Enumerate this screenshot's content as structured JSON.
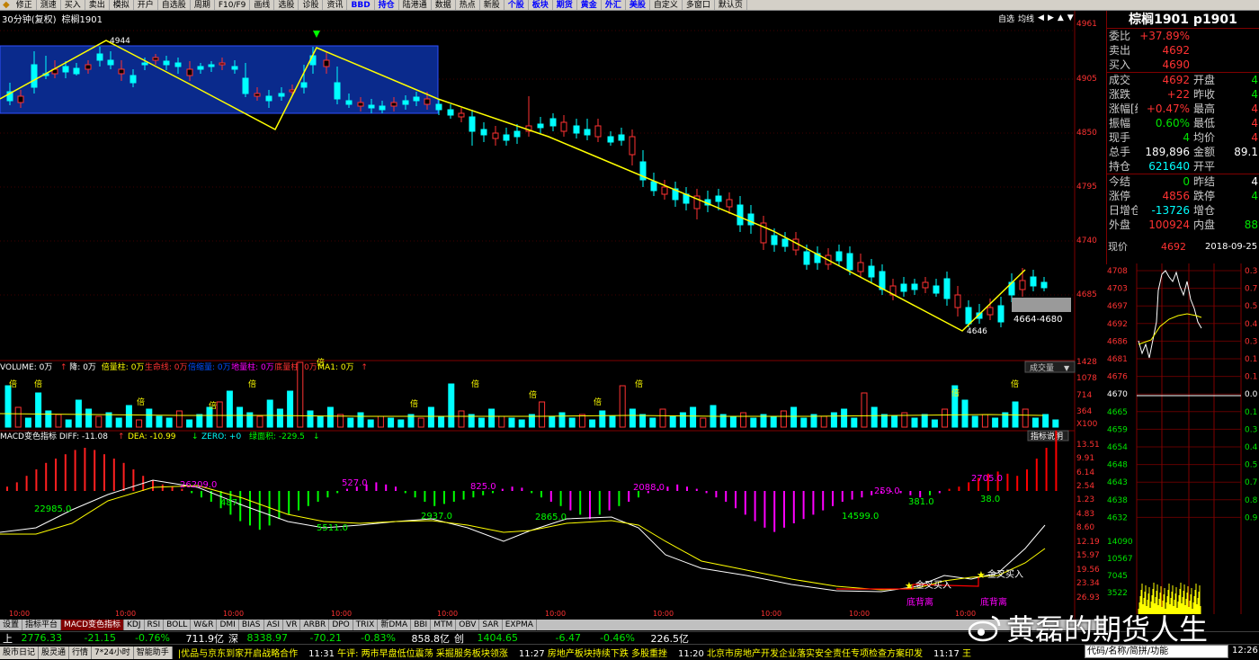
{
  "toolbar": {
    "items": [
      "修正",
      "测速",
      "买入",
      "卖出",
      "模拟",
      "开户",
      "自选股",
      "周期",
      "F10/F9",
      "画线",
      "选股",
      "诊股",
      "资讯",
      "BBD",
      "持仓",
      "陆港通",
      "数据",
      "热点",
      "新股",
      "个股",
      "板块",
      "期货",
      "黄金",
      "外汇",
      "美股",
      "自定义",
      "多窗口",
      "默认页"
    ]
  },
  "chart_header": {
    "period": "30分钟(复权)",
    "symbol": "棕榈1901",
    "tools": [
      "自选",
      "均线",
      "◀",
      "▶",
      "▲",
      "▼"
    ]
  },
  "quote": {
    "title": "棕榈1901  p1901",
    "rows": [
      {
        "l1": "委比",
        "v1": "+37.89%",
        "c1": "red",
        "l2": "",
        "v2": "",
        "c2": ""
      },
      {
        "l1": "卖出",
        "v1": "4692",
        "c1": "red",
        "l2": "",
        "v2": "",
        "c2": ""
      },
      {
        "l1": "买入",
        "v1": "4690",
        "c1": "red",
        "l2": "",
        "v2": "",
        "c2": ""
      },
      {
        "l1": "成交",
        "v1": "4692",
        "c1": "red",
        "l2": "开盘",
        "v2": "4",
        "c2": "green"
      },
      {
        "l1": "涨跌",
        "v1": "+22",
        "c1": "red",
        "l2": "昨收",
        "v2": "4",
        "c2": "green"
      },
      {
        "l1": "涨幅[结]",
        "v1": "+0.47%",
        "c1": "red",
        "l2": "最高",
        "v2": "4",
        "c2": "red"
      },
      {
        "l1": "振幅",
        "v1": "0.60%",
        "c1": "green",
        "l2": "最低",
        "v2": "4",
        "c2": "red"
      },
      {
        "l1": "现手",
        "v1": "4",
        "c1": "green",
        "l2": "均价",
        "v2": "4",
        "c2": "red"
      },
      {
        "l1": "总手",
        "v1": "189,896",
        "c1": "white",
        "l2": "金额",
        "v2": "89.1",
        "c2": "white"
      },
      {
        "l1": "持仓",
        "v1": "621640",
        "c1": "cyan",
        "l2": "开平",
        "v2": "",
        "c2": "cyan"
      },
      {
        "l1": "今结",
        "v1": "0",
        "c1": "green",
        "l2": "昨结",
        "v2": "4",
        "c2": "white"
      },
      {
        "l1": "涨停",
        "v1": "4856",
        "c1": "red",
        "l2": "跌停",
        "v2": "4",
        "c2": "green"
      },
      {
        "l1": "日增仓",
        "v1": "-13726",
        "c1": "cyan",
        "l2": "增仓",
        "v2": "",
        "c2": "white"
      },
      {
        "l1": "外盘",
        "v1": "100924",
        "c1": "red",
        "l2": "内盘",
        "v2": "88",
        "c2": "green"
      }
    ],
    "mini_label": "现价",
    "mini_price": "4692",
    "mini_date": "2018-09-25"
  },
  "price_axis": [
    "4961",
    "4905",
    "4850",
    "4795",
    "4740",
    "4685"
  ],
  "volume_axis": [
    "1428",
    "1078",
    "714",
    "364",
    "X100"
  ],
  "macd_axis": [
    "13.51",
    "9.91",
    "6.14",
    "2.54",
    "1.23",
    "4.83",
    "8.60",
    "12.19",
    "15.97",
    "19.56",
    "23.34",
    "26.93"
  ],
  "mini_axis_left": [
    "4708",
    "4703",
    "4697",
    "4692",
    "4686",
    "4681",
    "4676",
    "4670",
    "4665",
    "4659",
    "4654",
    "4648",
    "4643",
    "4638",
    "4632",
    "14090",
    "10567",
    "7045",
    "3522"
  ],
  "mini_axis_right": [
    "0.3",
    "0.7",
    "0.5",
    "0.4",
    "0.3",
    "0.1",
    "0.1",
    "0.0",
    "0.1",
    "0.3",
    "0.4",
    "0.5",
    "0.7",
    "0.8",
    "0.9"
  ],
  "annotations": {
    "high1": "4944",
    "low1": "4646",
    "zone": "4664-4680",
    "volume_legend": [
      {
        "t": "VOLUME: 0万",
        "c": "#ffffff"
      },
      {
        "t": "↑",
        "c": "#ff3232"
      },
      {
        "t": "降: 0万",
        "c": "#ffffff"
      },
      {
        "t": "倍量柱: 0万",
        "c": "#ffff00"
      },
      {
        "t": "生命线: 0万",
        "c": "#ff3232"
      },
      {
        "t": "倍缩量: 0万",
        "c": "#0050ff"
      },
      {
        "t": "地量柱: 0万",
        "c": "#ff00ff"
      },
      {
        "t": "底量柱: 0万",
        "c": "#ff3232"
      },
      {
        "t": "MA1: 0万",
        "c": "#ffff00"
      },
      {
        "t": "↑",
        "c": "#ff3232"
      }
    ],
    "volume_dropdown": "成交量",
    "macd_legend": [
      {
        "t": "MACD变色指标 DIFF: -11.08",
        "c": "#ffffff"
      },
      {
        "t": "↑",
        "c": "#ff3232"
      },
      {
        "t": "DEA: -10.99",
        "c": "#ffff00"
      },
      {
        "t": "↓",
        "c": "#00ff00"
      },
      {
        "t": "ZERO: +0",
        "c": "#00ffff"
      },
      {
        "t": "绿面积: -229.5",
        "c": "#00ff00"
      },
      {
        "t": "↓",
        "c": "#00ff00"
      }
    ],
    "macd_button": "指标说明",
    "macd_labels": [
      "22985.0",
      "26209.0",
      "487.",
      "527.0",
      "5511.0",
      "2937.0",
      "825.0",
      "2865.0",
      "2088.0",
      "14599.0",
      "259.0",
      "381.0",
      "2705.0",
      "38.0"
    ],
    "signals": [
      "金叉买入",
      "金叉买入",
      "底背离",
      "底背离"
    ],
    "vol_mark": "倍"
  },
  "time_axis": [
    "10:00",
    "10:00",
    "10:00",
    "10:00",
    "10:00",
    "10:00",
    "10:00",
    "10:00",
    "10:00",
    "10:00"
  ],
  "tabs": [
    "设置",
    "指标平台",
    "MACD变色指标",
    "KDJ",
    "RSI",
    "BOLL",
    "W&R",
    "DMI",
    "BIAS",
    "ASI",
    "VR",
    "ARBR",
    "DPO",
    "TRIX",
    "新DMA",
    "BBI",
    "MTM",
    "OBV",
    "SAR",
    "EXPMA"
  ],
  "indexbar": [
    {
      "t": "上",
      "c": "#ffffff"
    },
    {
      "t": "2776.33",
      "c": "#00e600"
    },
    {
      "t": "-21.15",
      "c": "#00e600"
    },
    {
      "t": "-0.76%",
      "c": "#00e600"
    },
    {
      "t": "711.9亿",
      "c": "#ffffff"
    },
    {
      "t": "深",
      "c": "#ffffff"
    },
    {
      "t": "8338.97",
      "c": "#00e600"
    },
    {
      "t": "-70.21",
      "c": "#00e600"
    },
    {
      "t": "-0.83%",
      "c": "#00e600"
    },
    {
      "t": "858.8亿",
      "c": "#ffffff"
    },
    {
      "t": "创",
      "c": "#ffffff"
    },
    {
      "t": "1404.65",
      "c": "#00e600"
    },
    {
      "t": "-6.47",
      "c": "#00e600"
    },
    {
      "t": "-0.46%",
      "c": "#00e600"
    },
    {
      "t": "226.5亿",
      "c": "#ffffff"
    }
  ],
  "ticker": {
    "nav": [
      "股市日记",
      "股灵通",
      "行情",
      "7*24小时",
      "智能助手"
    ],
    "news": [
      {
        "time": "",
        "text": "|优品与京东到家开启战略合作"
      },
      {
        "time": "11:31",
        "text": "午评: 两市早盘低位震荡 采掘服务板块领涨"
      },
      {
        "time": "11:27",
        "text": "房地产板块持续下跌 多股重挫"
      },
      {
        "time": "11:20",
        "text": "北京市房地产开发企业落实安全责任专项检查方案印发"
      },
      {
        "time": "11:17",
        "text": "王"
      }
    ],
    "search_placeholder": "代码/名称/简拼/功能",
    "clock": "12:26"
  },
  "watermark": "黄磊的期货人生",
  "colors": {
    "up": "#ff3232",
    "down": "#00ffff",
    "trend": "#ffff00",
    "box": "#0a2a8c",
    "grid": "#800000"
  }
}
